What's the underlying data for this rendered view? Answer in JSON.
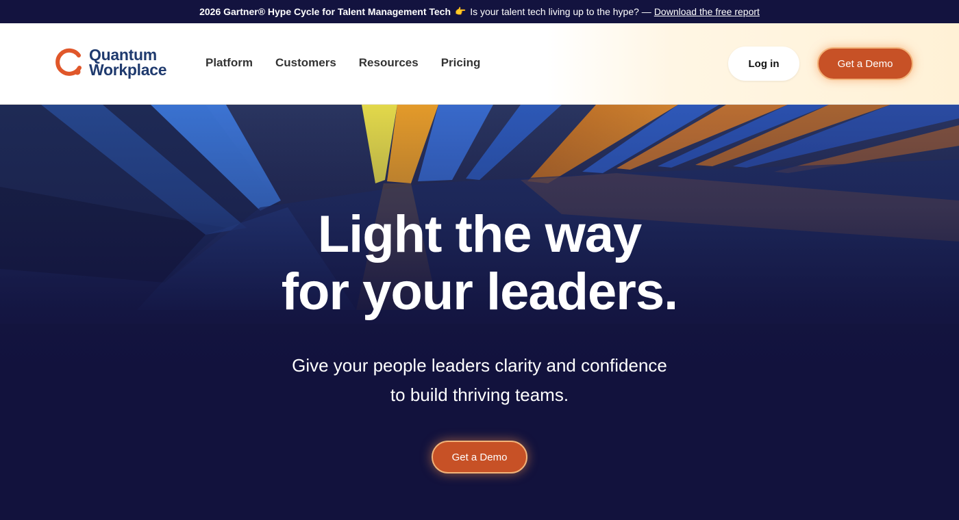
{
  "announcement": {
    "bold_text": "2026 Gartner® Hype Cycle for Talent Management Tech",
    "emoji": "👉",
    "text": "Is your talent tech living up to the hype? —",
    "link_text": "Download the free report"
  },
  "brand": {
    "line1": "Quantum",
    "line2": "Workplace",
    "icon": "quantum-q-logo"
  },
  "nav": {
    "items": [
      {
        "label": "Platform"
      },
      {
        "label": "Customers"
      },
      {
        "label": "Resources"
      },
      {
        "label": "Pricing"
      }
    ],
    "login_label": "Log in",
    "demo_label": "Get a Demo"
  },
  "hero": {
    "headline_line1": "Light the way",
    "headline_line2": "for your leaders.",
    "subhead_line1": "Give your people leaders clarity and confidence",
    "subhead_line2": "to build thriving teams.",
    "cta_label": "Get a Demo"
  },
  "colors": {
    "announcement_bg": "#13133f",
    "hero_bg": "#12123d",
    "accent": "#c75126",
    "brand_text": "#1f3a6e",
    "brand_icon": "#e0572a"
  }
}
